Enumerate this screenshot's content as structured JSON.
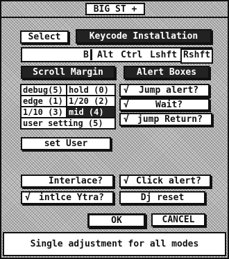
{
  "window": {
    "title": "BIG ST +"
  },
  "toolbar": {
    "select_label": "Select",
    "keycode_label": "Keycode Installation"
  },
  "keycode_field": {
    "cursor_char": "B",
    "modifiers": [
      "Alt",
      "Ctrl",
      "Lshft"
    ],
    "selected": "Rshft"
  },
  "scroll_margin": {
    "header": "Scroll Margin",
    "rows": [
      [
        "debug(5)",
        "hold (0)"
      ],
      [
        "edge (1)",
        "1/20 (2)"
      ],
      [
        "1/10 (3)",
        "mid (4)"
      ]
    ],
    "user_setting": "user setting (5)"
  },
  "alert_boxes": {
    "header": "Alert Boxes",
    "items": [
      {
        "check": "√",
        "label": "Jump alert?"
      },
      {
        "check": "√",
        "label": "Wait?"
      },
      {
        "check": "√",
        "label": "jump Return?"
      }
    ]
  },
  "set_user_label": "set User",
  "options": {
    "interlace": {
      "check": "",
      "label": "Interlace?"
    },
    "click_alert": {
      "check": "√",
      "label": "Click alert?"
    },
    "intlce_ytra": {
      "check": "√",
      "label": "intlce Ytra?"
    },
    "dj_reset": {
      "label": "Dj reset"
    }
  },
  "buttons": {
    "ok": "OK",
    "cancel": "CANCEL"
  },
  "status": "Single adjustment for all modes"
}
